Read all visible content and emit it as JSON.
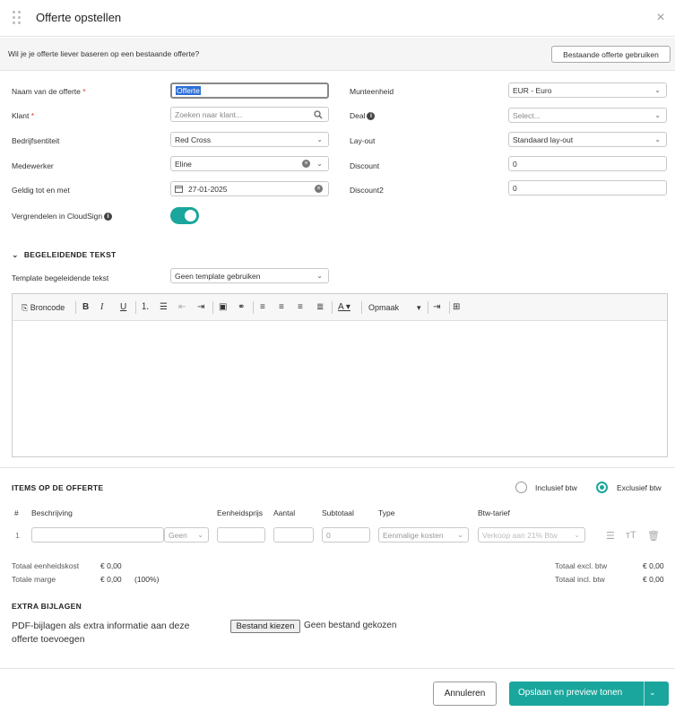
{
  "dialog": {
    "title": "Offerte opstellen",
    "close_icon": "×"
  },
  "base_bar": {
    "question": "Wil je je offerte liever baseren op een bestaande offerte?",
    "button": "Bestaande offerte gebruiken"
  },
  "form": {
    "name_label": "Naam van de offerte",
    "name_value": "Offerte",
    "client_label": "Klant",
    "client_placeholder": "Zoeken naar klant...",
    "entity_label": "Bedrijfsentiteit",
    "entity_value": "Red Cross",
    "employee_label": "Medewerker",
    "employee_value": "Eline",
    "valid_label": "Geldig tot en met",
    "valid_value": "27-01-2025",
    "lock_label": "Vergrendelen in CloudSign",
    "lock_on": true,
    "currency_label": "Munteenheid",
    "currency_value": "EUR - Euro",
    "deal_label": "Deal",
    "deal_placeholder": "Select...",
    "layout_label": "Lay-out",
    "layout_value": "Standaard lay-out",
    "discount_label": "Discount",
    "discount_value": "0",
    "discount2_label": "Discount2",
    "discount2_value": "0",
    "required_mark": "*"
  },
  "accompanying": {
    "heading": "BEGELEIDENDE TEKST",
    "template_label": "Template begeleidende tekst",
    "template_value": "Geen template gebruiken",
    "toolbar": {
      "source": "Broncode",
      "format": "Opmaak"
    }
  },
  "items": {
    "heading": "ITEMS OP DE OFFERTE",
    "incl_label": "Inclusief btw",
    "excl_label": "Exclusief btw",
    "selected": "excl",
    "columns": [
      "#",
      "Beschrijving",
      "Eenheidsprijs",
      "Aantal",
      "Subtotaal",
      "Type",
      "Btw-tarief"
    ],
    "row": {
      "index": "1",
      "unit": "Geen",
      "subtotal": "0",
      "type": "Eenmalige kosten",
      "vat": "Verkoop aan 21% Btw"
    },
    "totals": {
      "unit_cost_label": "Totaal eenheidskost",
      "unit_cost_value": "€ 0,00",
      "margin_label": "Totale marge",
      "margin_value": "€ 0,00",
      "margin_pct": "(100%)",
      "excl_label": "Totaal excl. btw",
      "excl_value": "€ 0,00",
      "incl_label": "Totaal incl. btw",
      "incl_value": "€ 0,00"
    }
  },
  "attachments": {
    "heading": "EXTRA BIJLAGEN",
    "description": "PDF-bijlagen als extra informatie aan deze offerte toevoegen",
    "choose_button": "Bestand kiezen",
    "no_file": "Geen bestand gekozen"
  },
  "footer": {
    "cancel": "Annuleren",
    "save": "Opslaan en preview tonen"
  },
  "colors": {
    "accent": "#1aa69c",
    "required": "#dd3333"
  }
}
